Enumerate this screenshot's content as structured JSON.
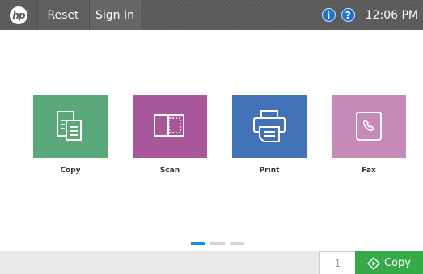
{
  "topbar": {
    "logo_text": "hp",
    "reset_label": "Reset",
    "signin_label": "Sign In",
    "info_icon": "i",
    "help_icon": "?",
    "time": "12:06 PM"
  },
  "tiles": [
    {
      "label": "Copy",
      "icon": "copy-document-icon",
      "color": "#5ba97a"
    },
    {
      "label": "Scan",
      "icon": "scan-icon",
      "color": "#a8579a"
    },
    {
      "label": "Print",
      "icon": "printer-icon",
      "color": "#4472b8"
    },
    {
      "label": "Fax",
      "icon": "phone-icon",
      "color": "#c58ab7"
    }
  ],
  "pagination": {
    "pages": 3,
    "active": 1
  },
  "bottombar": {
    "copies": "1",
    "copy_button_label": "Copy",
    "copy_button_color": "#38a94a"
  }
}
